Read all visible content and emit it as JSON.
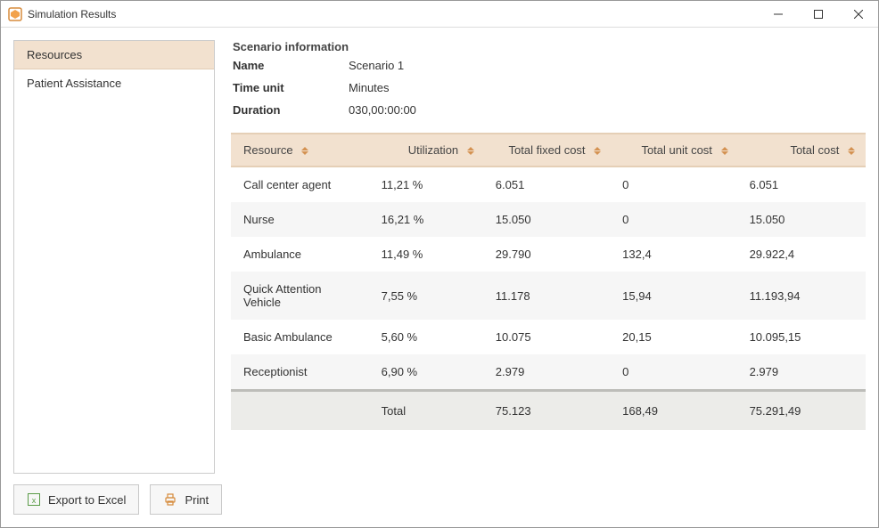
{
  "window": {
    "title": "Simulation Results"
  },
  "sidebar": {
    "items": [
      {
        "label": "Resources",
        "active": true
      },
      {
        "label": "Patient Assistance",
        "active": false
      }
    ]
  },
  "scenario": {
    "section_title": "Scenario information",
    "name_label": "Name",
    "name_value": "Scenario 1",
    "time_unit_label": "Time unit",
    "time_unit_value": "Minutes",
    "duration_label": "Duration",
    "duration_value": "030,00:00:00"
  },
  "table": {
    "headers": {
      "resource": "Resource",
      "utilization": "Utilization",
      "total_fixed_cost": "Total fixed cost",
      "total_unit_cost": "Total unit cost",
      "total_cost": "Total cost"
    },
    "rows": [
      {
        "resource": "Call center agent",
        "utilization": "11,21 %",
        "fixed": "6.051",
        "unit": "0",
        "total": "6.051"
      },
      {
        "resource": "Nurse",
        "utilization": "16,21 %",
        "fixed": "15.050",
        "unit": "0",
        "total": "15.050"
      },
      {
        "resource": "Ambulance",
        "utilization": "11,49 %",
        "fixed": "29.790",
        "unit": "132,4",
        "total": "29.922,4"
      },
      {
        "resource": "Quick Attention Vehicle",
        "utilization": "7,55 %",
        "fixed": "11.178",
        "unit": "15,94",
        "total": "11.193,94"
      },
      {
        "resource": "Basic Ambulance",
        "utilization": "5,60 %",
        "fixed": "10.075",
        "unit": "20,15",
        "total": "10.095,15"
      },
      {
        "resource": "Receptionist",
        "utilization": "6,90 %",
        "fixed": "2.979",
        "unit": "0",
        "total": "2.979"
      }
    ],
    "footer": {
      "label": "Total",
      "fixed": "75.123",
      "unit": "168,49",
      "total": "75.291,49"
    }
  },
  "buttons": {
    "export": "Export to Excel",
    "print": "Print"
  }
}
